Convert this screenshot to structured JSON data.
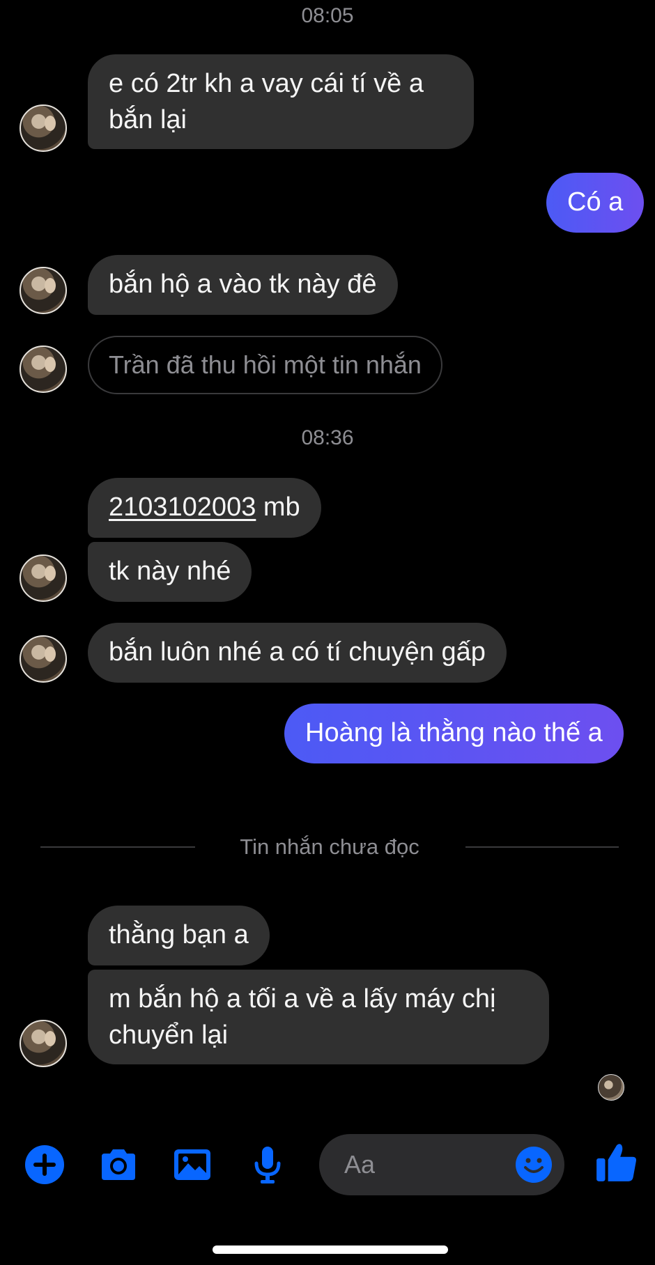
{
  "colors": {
    "accent": "#0866ff",
    "outgoing_start": "#4c5af5",
    "outgoing_end": "#6d4ff0",
    "incoming": "#303030"
  },
  "timestamps": {
    "first": "08:05",
    "second": "08:36"
  },
  "messages": {
    "m1": "e có 2tr kh a vay cái tí về a bắn lại",
    "m2": "Có a",
    "m3": "bắn hộ a vào tk này đê",
    "m4_recalled": "Trần đã thu hồi một tin nhắn",
    "m5_account": "2103102003",
    "m5_suffix": " mb",
    "m6": "tk này nhé",
    "m7": "bắn luôn nhé a có tí chuyện gấp",
    "m8": "Hoàng là thằng nào thế a",
    "m9": "thằng bạn a",
    "m10": "m bắn hộ a tối a về a lấy máy chị chuyển lại"
  },
  "unread_divider": "Tin nhắn chưa đọc",
  "composer": {
    "placeholder": "Aa"
  },
  "icons": [
    "plus-icon",
    "camera-icon",
    "gallery-icon",
    "microphone-icon",
    "emoji-icon",
    "like-icon"
  ]
}
